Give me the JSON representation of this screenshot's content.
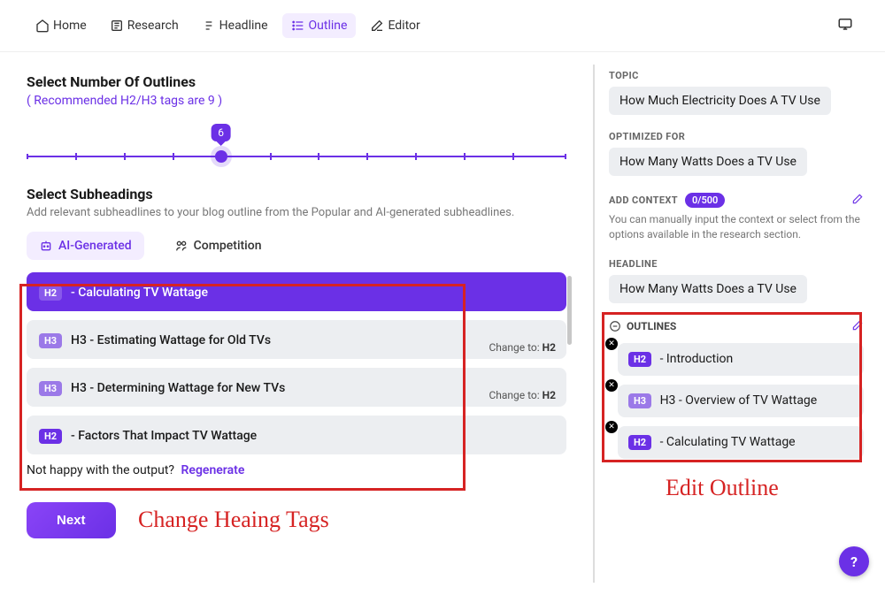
{
  "nav": {
    "items": [
      {
        "label": "Home"
      },
      {
        "label": "Research"
      },
      {
        "label": "Headline"
      },
      {
        "label": "Outline"
      },
      {
        "label": "Editor"
      }
    ],
    "active_index": 3
  },
  "left": {
    "outlines_title": "Select Number Of Outlines",
    "recommend": "( Recommended H2/H3 tags are 9 )",
    "slider_value": "6",
    "subheadings_title": "Select Subheadings",
    "subheadings_desc": "Add relevant subheadlines to your blog outline from the Popular and AI-generated subheadlines.",
    "tabs": [
      {
        "label": "AI-Generated"
      },
      {
        "label": "Competition"
      }
    ],
    "active_tab": 0,
    "cards": [
      {
        "tag": "H2",
        "text": "- Calculating TV Wattage",
        "selected": true
      },
      {
        "tag": "H3",
        "text": "H3 - Estimating Wattage for Old TVs",
        "change_to": "H2"
      },
      {
        "tag": "H3",
        "text": "H3 - Determining Wattage for New TVs",
        "change_to": "H2"
      },
      {
        "tag": "H2",
        "text": "- Factors That Impact TV Wattage"
      }
    ],
    "regen_prefix": "Not happy with the output?",
    "regen_link": "Regenerate",
    "change_to_label": "Change to:",
    "next": "Next"
  },
  "right": {
    "topic_label": "TOPIC",
    "topic": "How Much Electricity Does A TV Use",
    "optimized_label": "OPTIMIZED FOR",
    "optimized": "How Many Watts Does a TV Use",
    "context_label": "ADD CONTEXT",
    "context_count": "0/500",
    "context_desc": "You can manually input the context or select from the options available in the research section.",
    "headline_label": "HEADLINE",
    "headline": "How Many Watts Does a TV Use",
    "outlines_label": "OUTLINES",
    "outlines": [
      {
        "tag": "H2",
        "text": "- Introduction"
      },
      {
        "tag": "H3",
        "text": "H3 - Overview of TV Wattage"
      },
      {
        "tag": "H2",
        "text": "- Calculating TV Wattage"
      }
    ]
  },
  "annotations": {
    "left_label": "Change Heaing Tags",
    "right_label": "Edit Outline"
  },
  "help": "?"
}
